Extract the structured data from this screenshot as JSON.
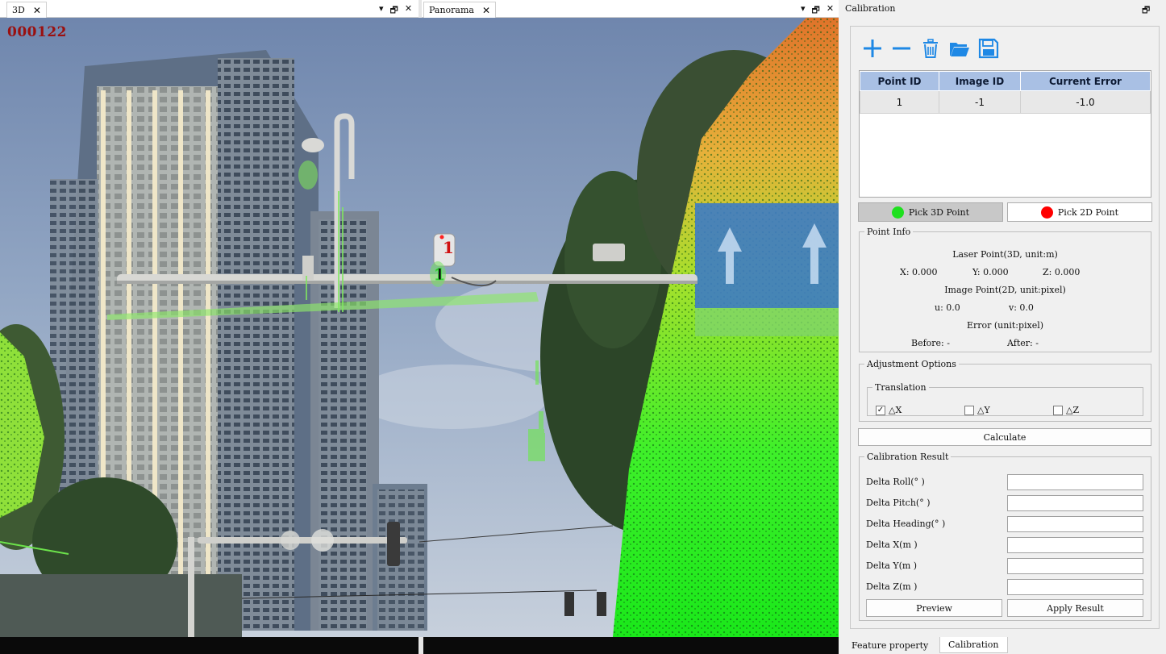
{
  "left_pane": {
    "tab_label": "3D",
    "close_glyph": "✕",
    "controls": {
      "dropdown": "▾",
      "restore": "🗗",
      "close": "✕"
    }
  },
  "middle_pane": {
    "tab_label": "Panorama",
    "close_glyph": "✕",
    "controls": {
      "dropdown": "▾",
      "restore": "🗗",
      "close": "✕"
    }
  },
  "scene": {
    "frame_counter": "000122",
    "marker_3d_label": "1",
    "marker_2d_label": "1"
  },
  "calibration": {
    "title": "Calibration",
    "restore_glyph": "🗗",
    "toolbar": [
      {
        "name": "add-point-icon",
        "color": "#1e88e5"
      },
      {
        "name": "remove-point-icon",
        "color": "#1e88e5"
      },
      {
        "name": "delete-icon",
        "color": "#1e88e5"
      },
      {
        "name": "open-folder-icon",
        "color": "#1e88e5"
      },
      {
        "name": "save-icon",
        "color": "#1e88e5"
      }
    ],
    "table": {
      "headers": [
        "Point ID",
        "Image ID",
        "Current Error"
      ],
      "rows": [
        [
          "1",
          "-1",
          "-1.0"
        ]
      ]
    },
    "pick_3d": {
      "label": "Pick 3D Point",
      "dot_color": "#1ee01e"
    },
    "pick_2d": {
      "label": "Pick 2D Point",
      "dot_color": "#ff0000"
    },
    "point_info": {
      "legend": "Point Info",
      "laser_title": "Laser Point(3D, unit:m)",
      "x_text": "X: 0.000",
      "y_text": "Y: 0.000",
      "z_text": "Z: 0.000",
      "image_title": "Image Point(2D, unit:pixel)",
      "u_text": "u: 0.0",
      "v_text": "v: 0.0",
      "error_title": "Error (unit:pixel)",
      "before_text": "Before: -",
      "after_text": "After: -"
    },
    "adjustment": {
      "legend": "Adjustment Options",
      "translation_legend": "Translation",
      "options": [
        {
          "label": "△X",
          "checked": true,
          "mark": "✓"
        },
        {
          "label": "△Y",
          "checked": false,
          "mark": ""
        },
        {
          "label": "△Z",
          "checked": false,
          "mark": ""
        }
      ]
    },
    "calculate_label": "Calculate",
    "result": {
      "legend": "Calibration Result",
      "fields": [
        {
          "label": "Delta Roll(° )",
          "value": ""
        },
        {
          "label": "Delta Pitch(° )",
          "value": ""
        },
        {
          "label": "Delta Heading(° )",
          "value": ""
        },
        {
          "label": "Delta X(m )",
          "value": ""
        },
        {
          "label": "Delta Y(m )",
          "value": ""
        },
        {
          "label": "Delta Z(m )",
          "value": ""
        }
      ]
    },
    "preview_label": "Preview",
    "apply_label": "Apply Result"
  },
  "bottom_tabs": [
    "Feature property",
    "Calibration"
  ]
}
